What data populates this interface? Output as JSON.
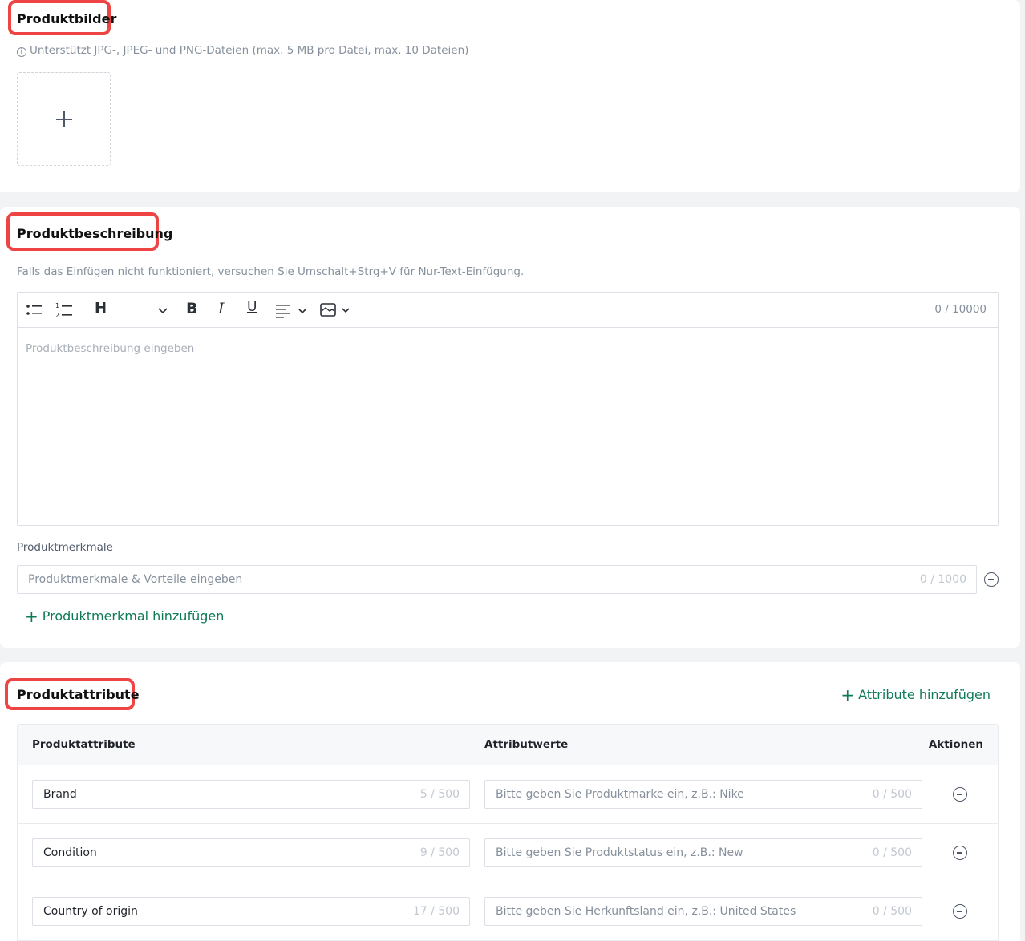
{
  "images": {
    "title": "Produktbilder",
    "hint": "Unterstützt JPG-, JPEG- und PNG-Dateien (max. 5 MB pro Datei, max. 10 Dateien)"
  },
  "description": {
    "title": "Produktbeschreibung",
    "hint": "Falls das Einfügen nicht funktioniert, versuchen Sie Umschalt+Strg+V für Nur-Text-Einfügung.",
    "toolbar": {
      "heading_label": "H",
      "bold_label": "B",
      "italic_label": "I",
      "underline_label": "U"
    },
    "counter": "0 / 10000",
    "placeholder": "Produktbeschreibung eingeben"
  },
  "features": {
    "label": "Produktmerkmale",
    "placeholder": "Produktmerkmale & Vorteile eingeben",
    "counter": "0 / 1000",
    "add_label": "Produktmerkmal hinzufügen"
  },
  "attributes": {
    "title": "Produktattribute",
    "add_label": "Attribute hinzufügen",
    "columns": [
      "Produktattribute",
      "Attributwerte",
      "Aktionen"
    ],
    "rows": [
      {
        "name": "Brand",
        "name_count": "5 / 500",
        "value_placeholder": "Bitte geben Sie Produktmarke ein, z.B.: Nike",
        "value_count": "0 / 500"
      },
      {
        "name": "Condition",
        "name_count": "9 / 500",
        "value_placeholder": "Bitte geben Sie Produktstatus ein, z.B.: New",
        "value_count": "0 / 500"
      },
      {
        "name": "Country of origin",
        "name_count": "17 / 500",
        "value_placeholder": "Bitte geben Sie Herkunftsland ein, z.B.: United States",
        "value_count": "0 / 500"
      }
    ]
  },
  "colors": {
    "accent": "#0f7a5a",
    "highlight": "#ee4444"
  }
}
